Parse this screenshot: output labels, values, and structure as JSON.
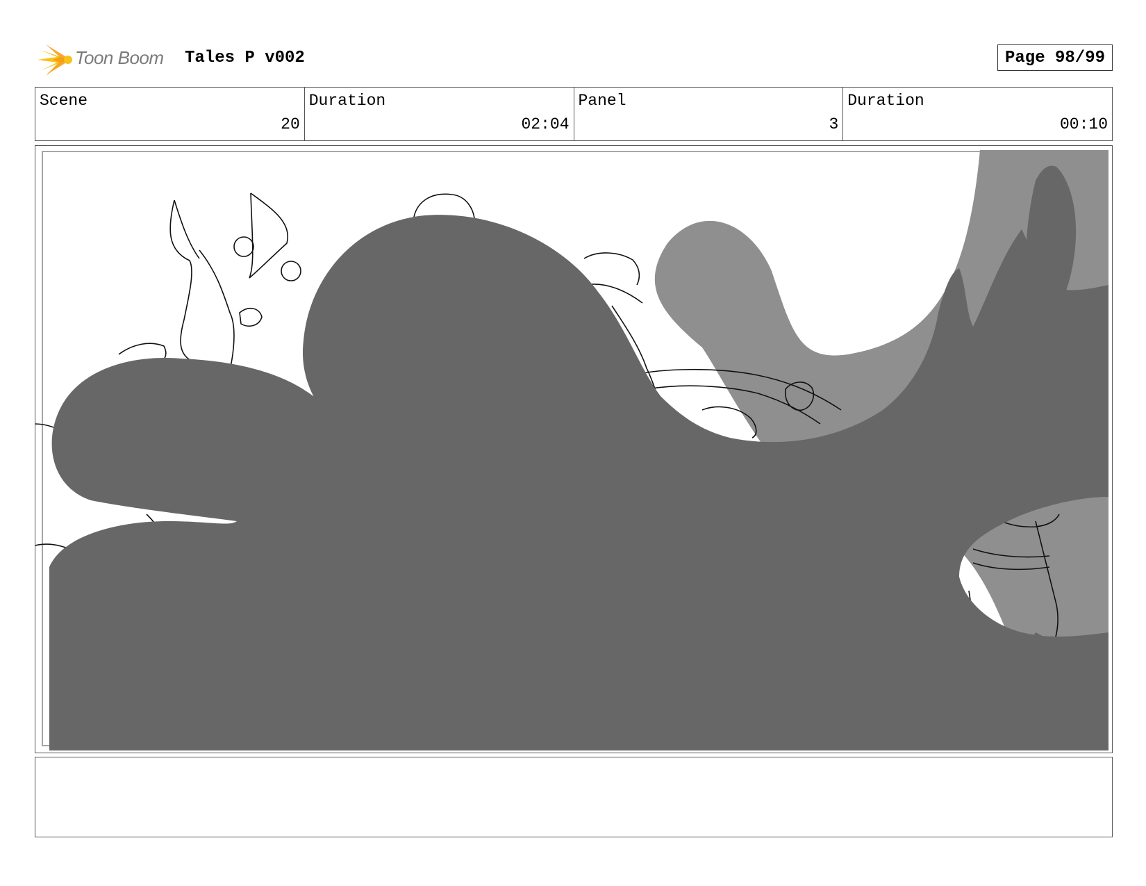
{
  "header": {
    "logo_text": "Toon Boom",
    "project_title": "Tales P v002",
    "page_label": "Page 98/99"
  },
  "info": {
    "scene_label": "Scene",
    "scene_value": "20",
    "scene_duration_label": "Duration",
    "scene_duration_value": "02:04",
    "panel_label": "Panel",
    "panel_value": "3",
    "panel_duration_label": "Duration",
    "panel_duration_value": "00:10"
  },
  "notes": {
    "text": ""
  },
  "colors": {
    "dark_fill": "#676767",
    "mid_fill": "#8f8f8f",
    "logo_yellow": "#f7c21a",
    "logo_orange": "#f39a12"
  }
}
